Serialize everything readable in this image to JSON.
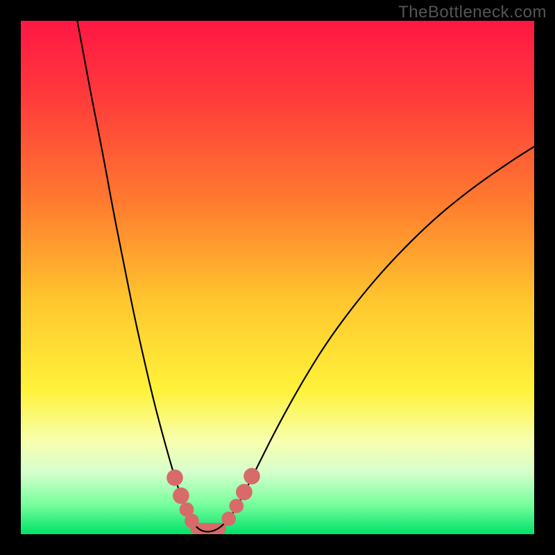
{
  "watermark": "TheBottleneck.com",
  "chart_data": {
    "type": "line",
    "title": "",
    "xlabel": "",
    "ylabel": "",
    "xlim": [
      0,
      100
    ],
    "ylim": [
      0,
      100
    ],
    "x_optimum": 36,
    "background_gradient": {
      "stops": [
        {
          "offset": 0.0,
          "color": "#ff1744"
        },
        {
          "offset": 0.15,
          "color": "#ff3b3b"
        },
        {
          "offset": 0.35,
          "color": "#ff7a2f"
        },
        {
          "offset": 0.55,
          "color": "#ffc82e"
        },
        {
          "offset": 0.72,
          "color": "#fff23a"
        },
        {
          "offset": 0.82,
          "color": "#f7ffb0"
        },
        {
          "offset": 0.88,
          "color": "#d4ffcc"
        },
        {
          "offset": 0.94,
          "color": "#7bff9e"
        },
        {
          "offset": 1.0,
          "color": "#00e269"
        }
      ]
    },
    "curve_points": [
      {
        "x": 11.0,
        "y": 100.0
      },
      {
        "x": 12.5,
        "y": 92.0
      },
      {
        "x": 14.0,
        "y": 84.0
      },
      {
        "x": 16.0,
        "y": 74.0
      },
      {
        "x": 18.0,
        "y": 63.0
      },
      {
        "x": 20.0,
        "y": 53.0
      },
      {
        "x": 22.0,
        "y": 43.0
      },
      {
        "x": 24.0,
        "y": 34.0
      },
      {
        "x": 26.0,
        "y": 25.5
      },
      {
        "x": 28.0,
        "y": 18.0
      },
      {
        "x": 30.0,
        "y": 11.0
      },
      {
        "x": 31.5,
        "y": 6.5
      },
      {
        "x": 33.0,
        "y": 3.0
      },
      {
        "x": 34.5,
        "y": 1.0
      },
      {
        "x": 36.0,
        "y": 0.4
      },
      {
        "x": 37.5,
        "y": 0.6
      },
      {
        "x": 39.0,
        "y": 1.4
      },
      {
        "x": 41.0,
        "y": 3.5
      },
      {
        "x": 43.0,
        "y": 7.0
      },
      {
        "x": 46.0,
        "y": 13.0
      },
      {
        "x": 50.0,
        "y": 21.0
      },
      {
        "x": 55.0,
        "y": 30.0
      },
      {
        "x": 60.0,
        "y": 38.0
      },
      {
        "x": 66.0,
        "y": 46.0
      },
      {
        "x": 72.0,
        "y": 53.0
      },
      {
        "x": 80.0,
        "y": 61.0
      },
      {
        "x": 88.0,
        "y": 67.5
      },
      {
        "x": 96.0,
        "y": 73.0
      },
      {
        "x": 100.0,
        "y": 75.5
      }
    ],
    "marker_dots": [
      {
        "x": 30.0,
        "y": 11.0,
        "r": 1.6
      },
      {
        "x": 31.2,
        "y": 7.5,
        "r": 1.6
      },
      {
        "x": 32.3,
        "y": 4.8,
        "r": 1.4
      },
      {
        "x": 33.3,
        "y": 2.6,
        "r": 1.4
      },
      {
        "x": 40.5,
        "y": 3.0,
        "r": 1.4
      },
      {
        "x": 42.0,
        "y": 5.5,
        "r": 1.4
      },
      {
        "x": 43.5,
        "y": 8.2,
        "r": 1.6
      },
      {
        "x": 45.0,
        "y": 11.3,
        "r": 1.6
      }
    ],
    "bottom_bar": {
      "x_start": 33.0,
      "x_end": 40.0,
      "height": 2.2
    },
    "colors": {
      "curve": "#000000",
      "markers": "#d86a6a",
      "bottom_bar": "#d86a6a"
    }
  }
}
